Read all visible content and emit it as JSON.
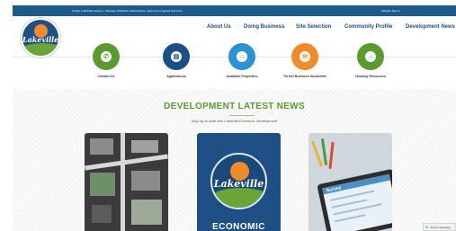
{
  "topbar": {
    "message": "Create a Website Account - Manage notification subscriptions, save form progress and more.",
    "signin": "Website Sign In"
  },
  "logo": {
    "text": "Lakeville"
  },
  "nav": {
    "items": [
      "About Us",
      "Doing Business",
      "Site Selection",
      "Community Profile",
      "Development News"
    ]
  },
  "quick_links": [
    {
      "label": "Contact Us",
      "icon": "phone-icon",
      "color": "#5b9a2f"
    },
    {
      "label": "Applications",
      "icon": "document-icon",
      "color": "#1c4f86"
    },
    {
      "label": "Available Properties",
      "icon": "home-icon",
      "color": "#2b93d1"
    },
    {
      "label": "Thrive! Business Newsletter",
      "icon": "mail-icon",
      "color": "#f08a2b"
    },
    {
      "label": "Housing Resources",
      "icon": "house-icon",
      "color": "#5b9a2f"
    }
  ],
  "news": {
    "title": "DEVELOPMENT LATEST NEWS",
    "subtitle": "Stay up-to-date with Lakeville Economic Development"
  },
  "cards": {
    "econ_logo_text": "Lakeville",
    "econ_text": "ECONOMIC",
    "survey_text": "Survey"
  },
  "translate": {
    "g": "G",
    "label": "Select Language"
  }
}
